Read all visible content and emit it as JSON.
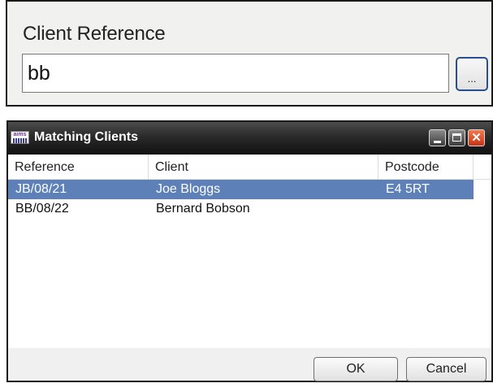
{
  "client_reference": {
    "label": "Client Reference",
    "value": "bb",
    "browse_label": "..."
  },
  "dialog": {
    "title": "Matching Clients",
    "icon_text": "aims",
    "controls": {
      "close_glyph": "✕"
    },
    "columns": [
      "Reference",
      "Client",
      "Postcode"
    ],
    "rows": [
      {
        "reference": "JB/08/21",
        "client": "Joe Bloggs",
        "postcode": "E4 5RT",
        "selected": true
      },
      {
        "reference": "BB/08/22",
        "client": "Bernard Bobson",
        "postcode": "",
        "selected": false
      }
    ],
    "buttons": {
      "ok": "OK",
      "cancel": "Cancel"
    }
  },
  "colors": {
    "selection": "#5d80b8",
    "titlebar": "#2a2a2a",
    "close_button": "#d9441c"
  }
}
